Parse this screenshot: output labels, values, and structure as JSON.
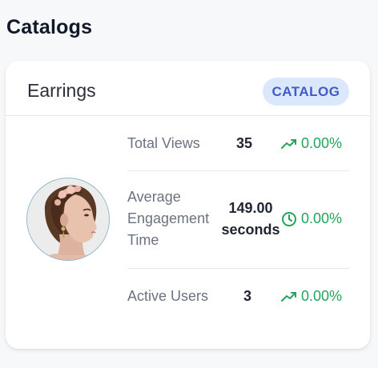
{
  "page": {
    "title": "Catalogs"
  },
  "card": {
    "title": "Earrings",
    "badge": "CATALOG",
    "avatar_alt": "Model wearing floral hair accessory and earrings"
  },
  "metrics": [
    {
      "label": "Total Views",
      "value": "35",
      "change": "0.00%",
      "change_icon": "trending-up-icon"
    },
    {
      "label_lines": [
        "Average",
        "Engagement",
        "Time"
      ],
      "value_lines": [
        "149.00",
        "seconds"
      ],
      "change": "0.00%",
      "change_icon": "clock-icon"
    },
    {
      "label": "Active Users",
      "value": "3",
      "change": "0.00%",
      "change_icon": "trending-up-icon"
    }
  ],
  "colors": {
    "positive": "#22a55a",
    "badge_bg": "#dbe8fb",
    "badge_text": "#3f5bc4"
  }
}
